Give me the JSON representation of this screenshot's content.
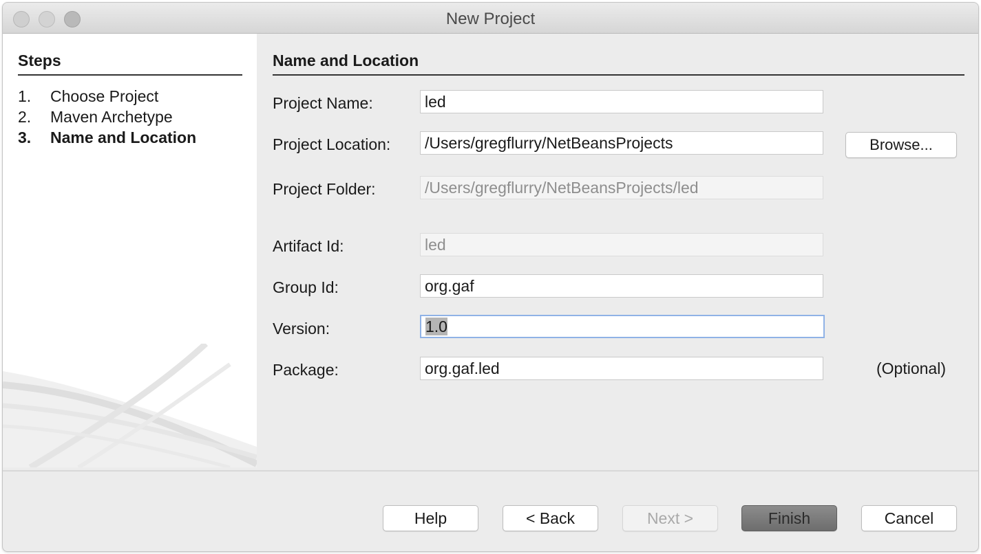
{
  "window": {
    "title": "New Project"
  },
  "steps": {
    "title": "Steps",
    "items": [
      {
        "num": "1.",
        "label": "Choose Project"
      },
      {
        "num": "2.",
        "label": "Maven Archetype"
      },
      {
        "num": "3.",
        "label": "Name and Location"
      }
    ],
    "current_step": 3
  },
  "form": {
    "title": "Name and Location",
    "project_name": {
      "label": "Project Name:",
      "value": "led"
    },
    "project_location": {
      "label": "Project Location:",
      "value": "/Users/gregflurry/NetBeansProjects"
    },
    "browse_label": "Browse...",
    "project_folder": {
      "label": "Project Folder:",
      "value": "/Users/gregflurry/NetBeansProjects/led"
    },
    "artifact_id": {
      "label": "Artifact Id:",
      "value": "led"
    },
    "group_id": {
      "label": "Group Id:",
      "value": "org.gaf"
    },
    "version": {
      "label": "Version:",
      "value": "1.0"
    },
    "package": {
      "label": "Package:",
      "value": "org.gaf.led",
      "note": "(Optional)"
    }
  },
  "buttons": {
    "help": "Help",
    "back": "< Back",
    "next": "Next >",
    "finish": "Finish",
    "cancel": "Cancel"
  },
  "colors": {
    "focus_ring": "#8fb2e6",
    "primary_button": "#7a7a7a"
  }
}
